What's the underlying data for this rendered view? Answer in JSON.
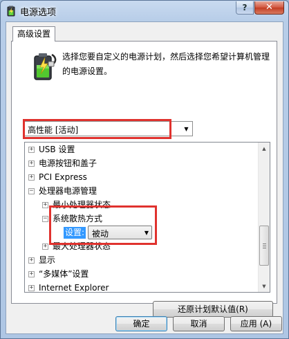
{
  "window": {
    "title": "电源选项",
    "help_label": "?",
    "close_label": "✕"
  },
  "tabs": [
    {
      "label": "高级设置"
    }
  ],
  "description": "选择您要自定义的电源计划，然后选择您希望计算机管理的电源设置。",
  "plan_select": {
    "value": "高性能 [活动]"
  },
  "tree": {
    "items": [
      {
        "label": "USB 设置",
        "expander": "+"
      },
      {
        "label": "电源按钮和盖子",
        "expander": "+"
      },
      {
        "label": "PCI Express",
        "expander": "+"
      },
      {
        "label": "处理器电源管理",
        "expander": "−"
      },
      {
        "label": "最小处理器状态",
        "expander": "+"
      },
      {
        "label": "系统散热方式",
        "expander": "−"
      },
      {
        "label": "最大处理器状态",
        "expander": "+"
      },
      {
        "label": "显示",
        "expander": "+"
      },
      {
        "label": "“多媒体”设置",
        "expander": "+"
      },
      {
        "label": "Internet Explorer",
        "expander": "+"
      }
    ],
    "setting": {
      "label": "设置:",
      "value": "被动"
    }
  },
  "buttons": {
    "restore": "还原计划默认值(R)",
    "ok": "确定",
    "cancel": "取消",
    "apply": "应用 (A)"
  },
  "colors": {
    "highlight": "#e0322e",
    "selection": "#3399ff"
  }
}
